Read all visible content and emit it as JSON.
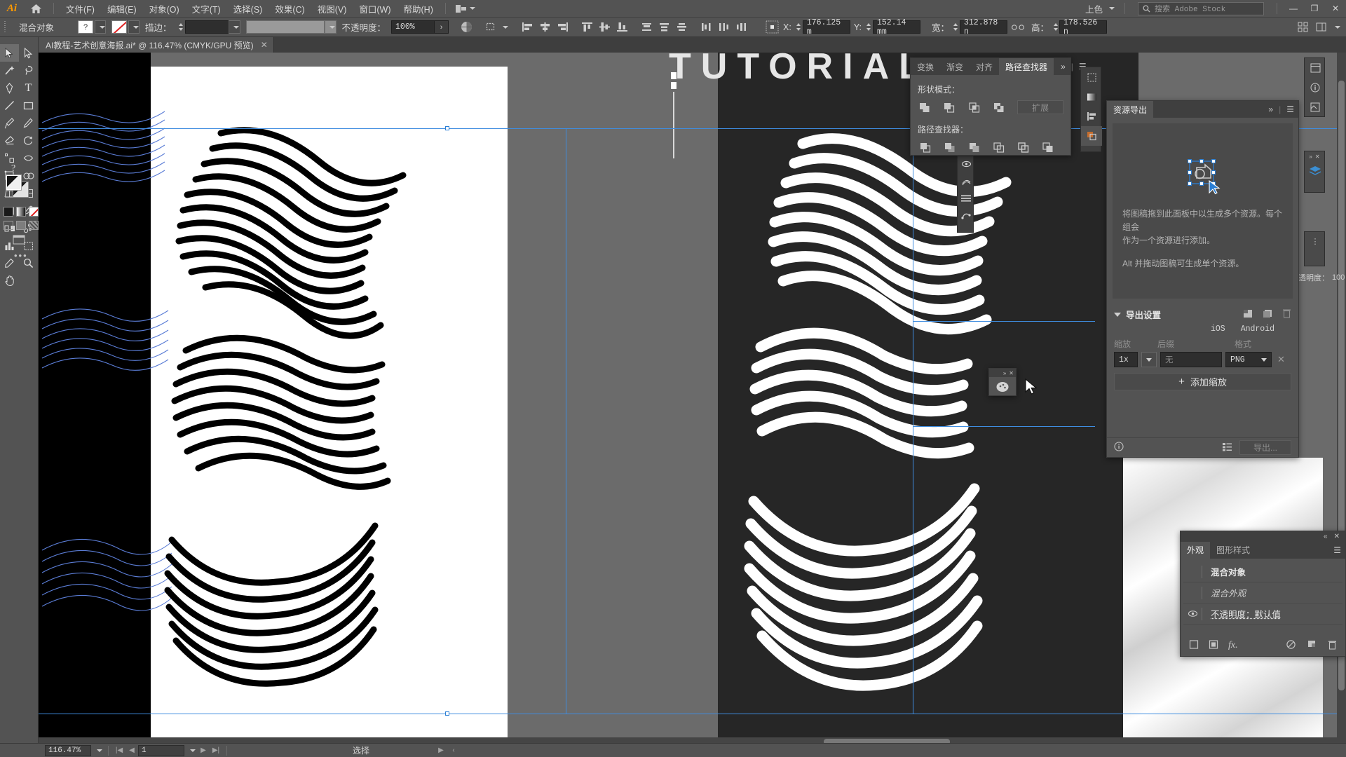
{
  "app": {
    "logo": "Ai",
    "home_icon": "home-icon",
    "arrange_icon": "arrange-documents-icon"
  },
  "menu": {
    "items": [
      {
        "label": "文件(F)"
      },
      {
        "label": "编辑(E)"
      },
      {
        "label": "对象(O)"
      },
      {
        "label": "文字(T)"
      },
      {
        "label": "选择(S)"
      },
      {
        "label": "效果(C)"
      },
      {
        "label": "视图(V)"
      },
      {
        "label": "窗口(W)"
      },
      {
        "label": "帮助(H)"
      }
    ],
    "workspace": "上色",
    "search_placeholder": "搜索 Adobe Stock",
    "search_icon": "search-icon",
    "window_buttons": {
      "minimize": "—",
      "restore": "❐",
      "close": "✕"
    }
  },
  "controlbar": {
    "object_label": "混合对象",
    "fill_swatch": "?",
    "stroke_none_swatch": "none-swatch",
    "stroke_label": "描边：",
    "stroke_weight": "",
    "stroke_profile": "",
    "opacity_label": "不透明度：",
    "opacity_value": "100%",
    "opacity_arrow": "›",
    "transparency_icon": "opacity-grid-icon",
    "transform_icon": "transform-icon",
    "align_icons": [
      "align-left-icon",
      "align-center-h-icon",
      "align-right-icon",
      "align-top-icon",
      "align-middle-v-icon",
      "align-bottom-icon",
      "distribute-top-icon",
      "distribute-center-v-icon",
      "distribute-bottom-icon",
      "distribute-left-icon",
      "distribute-center-h-icon",
      "distribute-right-icon"
    ],
    "reference_point_icon": "reference-point-grid-icon",
    "x_label": "X:",
    "x_value": "176.125 m",
    "x_unit": "m",
    "y_label": "Y:",
    "y_value": "152.14 mm",
    "w_label": "宽：",
    "w_value": "312.878 n",
    "link_icon": "link-broken-icon",
    "h_label": "高：",
    "h_value": "178.526 n",
    "more_icon": "more-options-icon",
    "panel_icon": "panel-options-icon"
  },
  "document_tab": {
    "title": "AI教程-艺术创意海报.ai* @ 116.47% (CMYK/GPU 预览)",
    "close_icon": "close-icon"
  },
  "toolbar": {
    "tools": [
      {
        "name": "selection-tool",
        "glyph": "selection"
      },
      {
        "name": "direct-selection-tool",
        "glyph": "direct-selection"
      },
      {
        "name": "magic-wand-tool",
        "glyph": "magic-wand"
      },
      {
        "name": "lasso-tool",
        "glyph": "lasso"
      },
      {
        "name": "pen-tool",
        "glyph": "pen"
      },
      {
        "name": "type-tool",
        "glyph": "T"
      },
      {
        "name": "line-segment-tool",
        "glyph": "line"
      },
      {
        "name": "rectangle-tool",
        "glyph": "rect"
      },
      {
        "name": "paintbrush-tool",
        "glyph": "brush"
      },
      {
        "name": "shaper-tool",
        "glyph": "shaper"
      },
      {
        "name": "eraser-tool",
        "glyph": "eraser"
      },
      {
        "name": "rotate-tool",
        "glyph": "rotate"
      },
      {
        "name": "scale-tool",
        "glyph": "scale"
      },
      {
        "name": "width-tool",
        "glyph": "width"
      },
      {
        "name": "free-transform-tool",
        "glyph": "free-transform"
      },
      {
        "name": "shape-builder-tool",
        "glyph": "shape-builder"
      },
      {
        "name": "perspective-grid-tool",
        "glyph": "perspective"
      },
      {
        "name": "mesh-tool",
        "glyph": "mesh"
      },
      {
        "name": "gradient-tool",
        "glyph": "gradient"
      },
      {
        "name": "eyedropper-tool",
        "glyph": "eyedropper"
      },
      {
        "name": "blend-tool",
        "glyph": "blend"
      },
      {
        "name": "symbol-sprayer-tool",
        "glyph": "symbol"
      },
      {
        "name": "column-graph-tool",
        "glyph": "graph"
      },
      {
        "name": "artboard-tool",
        "glyph": "artboard"
      },
      {
        "name": "slice-tool",
        "glyph": "slice"
      },
      {
        "name": "zoom-tool",
        "glyph": "zoom"
      },
      {
        "name": "hand-tool",
        "glyph": "hand"
      }
    ],
    "help_icon": "question-mark-icon",
    "fill_stroke_icon": "fill-stroke-swatches",
    "color_modes": [
      "color-icon",
      "gradient-icon",
      "none-icon"
    ],
    "screen_mode_icon": "screen-mode-icon",
    "more_tools_icon": "edit-toolbar-icon"
  },
  "pathfinder_panel": {
    "tabs": [
      {
        "label": "变换",
        "active": false
      },
      {
        "label": "渐变",
        "active": false
      },
      {
        "label": "对齐",
        "active": false
      },
      {
        "label": "路径查找器",
        "active": true
      }
    ],
    "collapse_icon": "double-chevron-icon",
    "menu_icon": "panel-menu-icon",
    "shape_modes_label": "形状模式：",
    "shape_mode_buttons": [
      "unite-icon",
      "minus-front-icon",
      "intersect-icon",
      "exclude-icon"
    ],
    "expand_button": "扩展",
    "pathfinders_label": "路径查找器：",
    "pathfinder_buttons": [
      "divide-icon",
      "trim-icon",
      "merge-icon",
      "crop-icon",
      "outline-icon",
      "minus-back-icon"
    ]
  },
  "asset_export": {
    "tab": "资源导出",
    "collapse_icon": "double-chevron-icon",
    "menu_icon": "panel-menu-icon",
    "close_icon": "close-icon",
    "drop_icon": "drag-artwork-icon",
    "hint_line1": "将图稿拖到此面板中以生成多个资源。每个组会",
    "hint_line2": "作为一个资源进行添加。",
    "hint_line3": "Alt 并拖动图稿可生成单个资源。",
    "export_settings_label": "导出设置",
    "launch_icons": [
      "export-preset-icon",
      "export-multiple-icon",
      "delete-icon"
    ],
    "platforms": [
      "iOS",
      "Android"
    ],
    "columns": {
      "scale": "缩放",
      "suffix": "后缀",
      "format": "格式"
    },
    "row": {
      "scale_value": "1x",
      "suffix_placeholder": "无",
      "format_value": "PNG",
      "remove_icon": "close-icon"
    },
    "add_scale_button": "添加缩放",
    "info_icon": "info-icon",
    "settings_icon": "export-settings-icon",
    "export_button": "导出..."
  },
  "appearance_panel": {
    "tabs": [
      {
        "label": "外观",
        "active": true
      },
      {
        "label": "图形样式",
        "active": false
      }
    ],
    "collapse_icon": "double-chevron-icon",
    "close_icon": "close-icon",
    "menu_icon": "panel-menu-icon",
    "rows": [
      {
        "label": "混合对象",
        "style": "bold",
        "eye": false
      },
      {
        "label": "混合外观",
        "style": "italic",
        "eye": false
      },
      {
        "label": "不透明度：默认值",
        "style": "underline",
        "eye": true
      }
    ],
    "footer_icons": [
      "add-new-stroke-icon",
      "add-new-fill-icon",
      "add-fx-icon",
      "clear-appearance-icon",
      "duplicate-item-icon",
      "delete-item-icon"
    ]
  },
  "right_dock": {
    "items": [
      "transform-icon",
      "gradient-icon",
      "align-icon",
      "pathfinder-icon"
    ],
    "far_items": [
      "properties-icon",
      "info-icon",
      "libraries-icon",
      "layers-icon"
    ],
    "opacity_label": "透明度：",
    "opacity_value": "100"
  },
  "floating_tools": {
    "items": [
      "eyedropper-icon",
      "gradient-mesh-icon",
      "menu-lines-icon",
      "blend-icon"
    ]
  },
  "mini_palette": {
    "collapse_icon": "double-chevron-icon",
    "close_icon": "close-icon",
    "swatch_icon": "color-wheel-icon"
  },
  "statusbar": {
    "zoom": "116.47%",
    "zoom_caret": "chevron-down-icon",
    "nav_first": "first-artboard-icon",
    "nav_prev": "prev-artboard-icon",
    "page": "1",
    "page_caret": "chevron-down-icon",
    "nav_next": "next-artboard-icon",
    "nav_last": "last-artboard-icon",
    "status_text": "选择",
    "play_icon": "play-icon",
    "back_icon": "chevron-left-icon"
  }
}
